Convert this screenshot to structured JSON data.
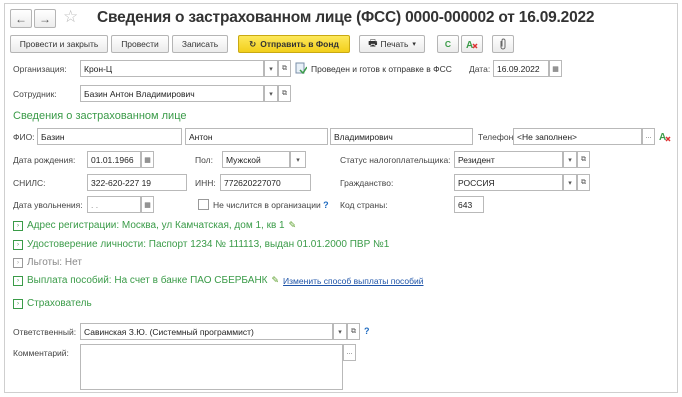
{
  "window": {
    "title": "Сведения о застрахованном лице (ФСС) 0000-000002 от 16.09.2022"
  },
  "toolbar": {
    "post_close": "Провести и закрыть",
    "post": "Провести",
    "save": "Записать",
    "send": "Отправить в Фонд",
    "print": "Печать"
  },
  "header": {
    "org_label": "Организация:",
    "org_value": "Крон-Ц",
    "status_text": "Проведен и готов к отправке в ФСС",
    "date_label": "Дата:",
    "date_value": "16.09.2022",
    "employee_label": "Сотрудник:",
    "employee_value": "Базин Антон Владимирович"
  },
  "insured": {
    "section_title": "Сведения о застрахованном лице",
    "fio_label": "ФИО:",
    "last_name": "Базин",
    "first_name": "Антон",
    "middle_name": "Владимирович",
    "phone_label": "Телефон:",
    "phone_value": "<Не заполнен>",
    "birth_label": "Дата рождения:",
    "birth_value": "01.01.1966",
    "gender_label": "Пол:",
    "gender_value": "Мужской",
    "taxstatus_label": "Статус налогоплательщика:",
    "taxstatus_value": "Резидент",
    "snils_label": "СНИЛС:",
    "snils_value": "322-620-227 19",
    "inn_label": "ИНН:",
    "inn_value": "772620227070",
    "citizenship_label": "Гражданство:",
    "citizenship_value": "РОССИЯ",
    "dismissal_label": "Дата увольнения:",
    "dismissal_value": " .  .",
    "not_listed_label": "Не числится в организации",
    "country_code_label": "Код страны:",
    "country_code_value": "643"
  },
  "groups": {
    "address": "Адрес регистрации: Москва, ул Камчатская, дом 1, кв 1",
    "identity": "Удостоверение личности: Паспорт 1234 № 111113, выдан 01.01.2000 ПВР №1",
    "benefits": "Льготы: Нет",
    "payment": "Выплата пособий: На счет в банке ПАО СБЕРБАНК",
    "payment_link": "Изменить способ выплаты пособий",
    "insurer": "Страхователь"
  },
  "footer": {
    "responsible_label": "Ответственный:",
    "responsible_value": "Савинская З.Ю. (Системный программист)",
    "comment_label": "Комментарий:",
    "comment_value": ""
  },
  "glyphs": {
    "back": "←",
    "forward": "→",
    "star": "☆",
    "dropdown": "▾",
    "open": "⧉",
    "calendar": "▦",
    "refresh": "C",
    "question": "?",
    "ellipsis": "...",
    "expand": "›",
    "pencil": "✎",
    "printer": "🖶",
    "clip": "⌀",
    "send_icon": "↻"
  }
}
